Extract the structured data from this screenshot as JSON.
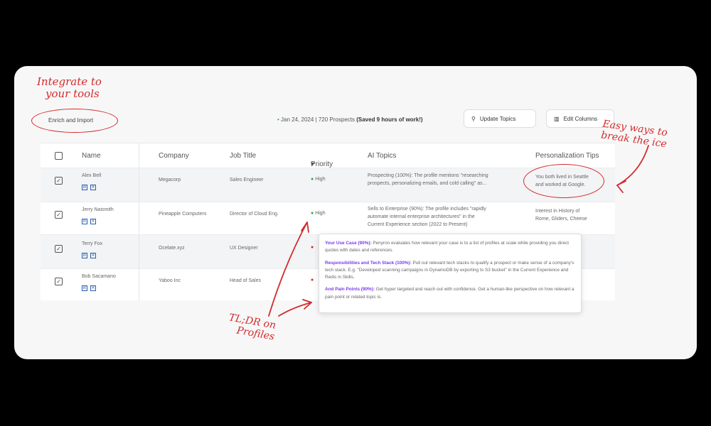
{
  "annotations": {
    "integrate": [
      "Integrate to",
      "your tools"
    ],
    "easy": [
      "Easy ways to",
      "break the ice"
    ],
    "tldr": [
      "TL;DR on",
      "Profiles"
    ]
  },
  "toolbar": {
    "enrich_label": "Enrich and Import",
    "date": "Jan 24, 2024",
    "prospects": "720 Prospects",
    "saved": "(Saved 9 hours of work!)",
    "update_topics": "Update Topics",
    "edit_columns": "Edit Columns"
  },
  "table": {
    "headers": {
      "name": "Name",
      "company": "Company",
      "job_title": "Job Title",
      "priority": "Priority",
      "ai_topics": "AI Topics",
      "tips": "Personalization Tips"
    },
    "rows": [
      {
        "name": "Alex Bell",
        "company": "Megacorp",
        "job": "Sales Engineer",
        "priority": "High",
        "topics": [
          "Prospecting (100%): The profile mentions \"researching",
          "prospects, personalizing emails, and cold calling\" as..."
        ],
        "tips": [
          "You both lived in Seattle",
          "and worked at Google."
        ]
      },
      {
        "name": "Jerry Naismith",
        "company": "Pineapple Computers",
        "job": "Director of Cloud Eng.",
        "priority": "High",
        "topics": [
          "Sells to Enterprise (90%): The profile includes \"rapidly",
          "automate internal enterprise architectures\" in the",
          "Current Experience section (2022 to Present)"
        ],
        "tips": [
          "Interest in History of",
          "Rome, Gliders, Cheese"
        ]
      },
      {
        "name": "Terry Fox",
        "company": "Ocelate.xyz",
        "job": "UX Designer",
        "priority": "",
        "topics": [],
        "tips": []
      },
      {
        "name": "Bob Sacamano",
        "company": "Yaboo Inc",
        "job": "Head of Sales",
        "priority": "",
        "topics": [],
        "tips": []
      }
    ]
  },
  "tooltip": {
    "p1_head": "Your Use Case (90%):",
    "p1_body": " Penyron evaluates how relevant your case is to a list of profiles at scale while providing you direct quotes with dates and references.",
    "p2_head": "Responsibilities and Tech Stack (100%):",
    "p2_body": " Pull out relevant tech stacks to qualify a prospect or make sense of a company's tech stack. E.g. \"Developed scanning campaigns in DynamoDB by exporting to S3 bucket\" in the Current Experience and Redis in Skills.",
    "p3_head": "And Pain Points (90%):",
    "p3_body": " Get hyper targeted and reach out with confidence. Get a human-like perspective on how relevant a pain point or related topic is."
  }
}
